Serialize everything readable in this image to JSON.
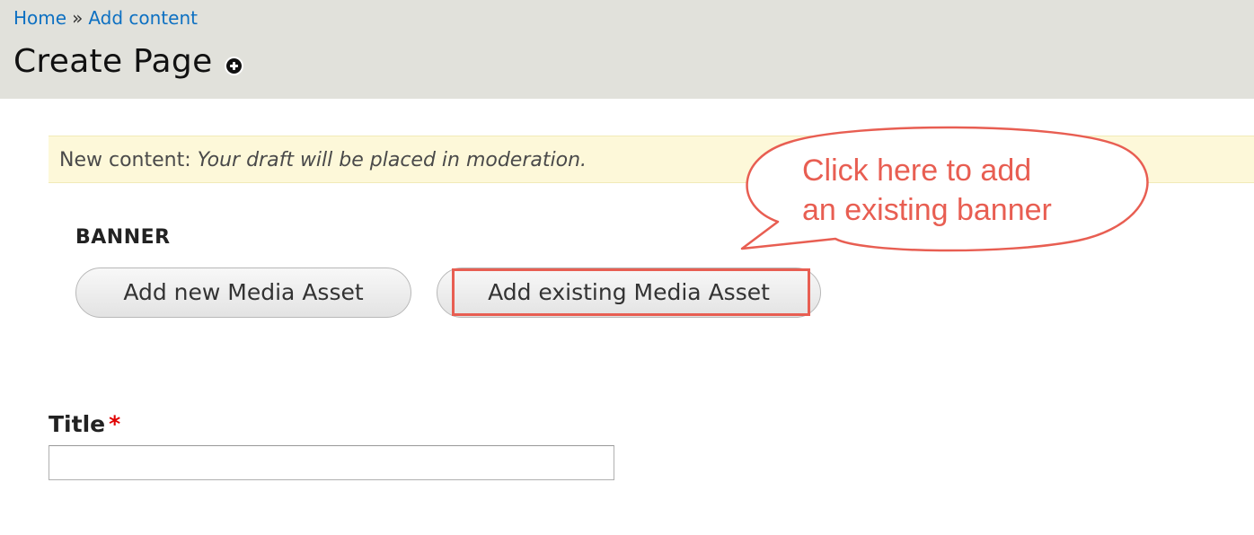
{
  "breadcrumb": {
    "home": "Home",
    "separator": "»",
    "add_content": "Add content"
  },
  "page": {
    "title": "Create Page",
    "shortcut_icon": "plus-circle-icon"
  },
  "message": {
    "prefix": "New content:",
    "text": "Your draft will be placed in moderation."
  },
  "banner": {
    "label": "BANNER",
    "add_new_label": "Add new Media Asset",
    "add_existing_label": "Add existing Media Asset"
  },
  "callout": {
    "line1": "Click here to add",
    "line2": "an existing banner",
    "color": "#e85e52"
  },
  "title_field": {
    "label": "Title",
    "required_marker": "*",
    "value": ""
  },
  "colors": {
    "header_bg": "#e1e1db",
    "link": "#0d70c2",
    "message_bg": "#fdf8d9",
    "annotation": "#e85e52",
    "required": "#e00000"
  }
}
